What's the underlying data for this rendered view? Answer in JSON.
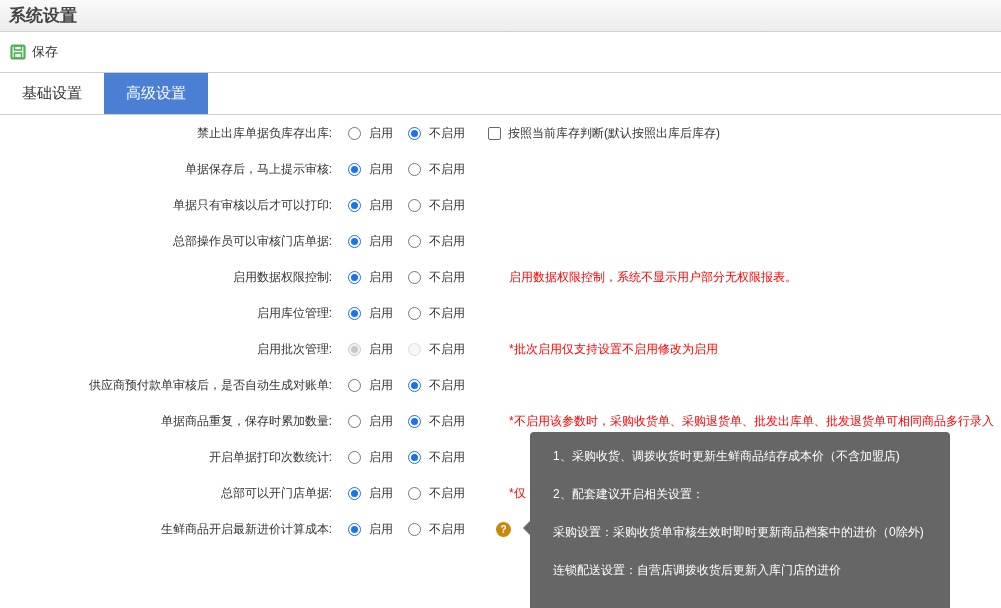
{
  "window": {
    "title": "系统设置"
  },
  "toolbar": {
    "save": "保存"
  },
  "tabs": [
    {
      "label": "基础设置",
      "selected": false
    },
    {
      "label": "高级设置",
      "selected": true
    }
  ],
  "settings": [
    {
      "label": "禁止出库单据负库存出库:",
      "disabled": false,
      "options": [
        {
          "label": "启用",
          "selected": false
        },
        {
          "label": "不启用",
          "selected": true
        }
      ],
      "checkbox": {
        "label": "按照当前库存判断(默认按照出库后库存)",
        "checked": false
      }
    },
    {
      "label": "单据保存后，马上提示审核:",
      "disabled": false,
      "options": [
        {
          "label": "启用",
          "selected": true
        },
        {
          "label": "不启用",
          "selected": false
        }
      ]
    },
    {
      "label": "单据只有审核以后才可以打印:",
      "disabled": false,
      "options": [
        {
          "label": "启用",
          "selected": true
        },
        {
          "label": "不启用",
          "selected": false
        }
      ]
    },
    {
      "label": "总部操作员可以审核门店单据:",
      "disabled": false,
      "options": [
        {
          "label": "启用",
          "selected": true
        },
        {
          "label": "不启用",
          "selected": false
        }
      ]
    },
    {
      "label": "启用数据权限控制:",
      "disabled": false,
      "options": [
        {
          "label": "启用",
          "selected": true
        },
        {
          "label": "不启用",
          "selected": false
        }
      ],
      "note": "启用数据权限控制，系统不显示用户部分无权限报表。"
    },
    {
      "label": "启用库位管理:",
      "disabled": false,
      "options": [
        {
          "label": "启用",
          "selected": true
        },
        {
          "label": "不启用",
          "selected": false
        }
      ]
    },
    {
      "label": "启用批次管理:",
      "disabled": true,
      "options": [
        {
          "label": "启用",
          "selected": true
        },
        {
          "label": "不启用",
          "selected": false
        }
      ],
      "note": "*批次启用仅支持设置不启用修改为启用"
    },
    {
      "label": "供应商预付款单审核后，是否自动生成对账单:",
      "disabled": false,
      "options": [
        {
          "label": "启用",
          "selected": false
        },
        {
          "label": "不启用",
          "selected": true
        }
      ]
    },
    {
      "label": "单据商品重复，保存时累加数量:",
      "disabled": false,
      "options": [
        {
          "label": "启用",
          "selected": false
        },
        {
          "label": "不启用",
          "selected": true
        }
      ],
      "note": "*不启用该参数时，采购收货单、采购退货单、批发出库单、批发退货单可相同商品多行录入"
    },
    {
      "label": "开启单据打印次数统计:",
      "disabled": false,
      "options": [
        {
          "label": "启用",
          "selected": false
        },
        {
          "label": "不启用",
          "selected": true
        }
      ]
    },
    {
      "label": "总部可以开门店单据:",
      "disabled": false,
      "options": [
        {
          "label": "启用",
          "selected": true
        },
        {
          "label": "不启用",
          "selected": false
        }
      ],
      "note": "*仅"
    },
    {
      "label": "生鲜商品开启最新进价计算成本:",
      "disabled": false,
      "options": [
        {
          "label": "启用",
          "selected": true
        },
        {
          "label": "不启用",
          "selected": false
        }
      ],
      "help": "?"
    }
  ],
  "tooltip": {
    "lines": [
      "1、采购收货、调拨收货时更新生鲜商品结存成本价（不含加盟店)",
      "2、配套建议开启相关设置：",
      "采购设置：采购收货单审核生效时即时更新商品档案中的进价（0除外)",
      "连锁配送设置：自营店调拨收货后更新入库门店的进价"
    ]
  }
}
